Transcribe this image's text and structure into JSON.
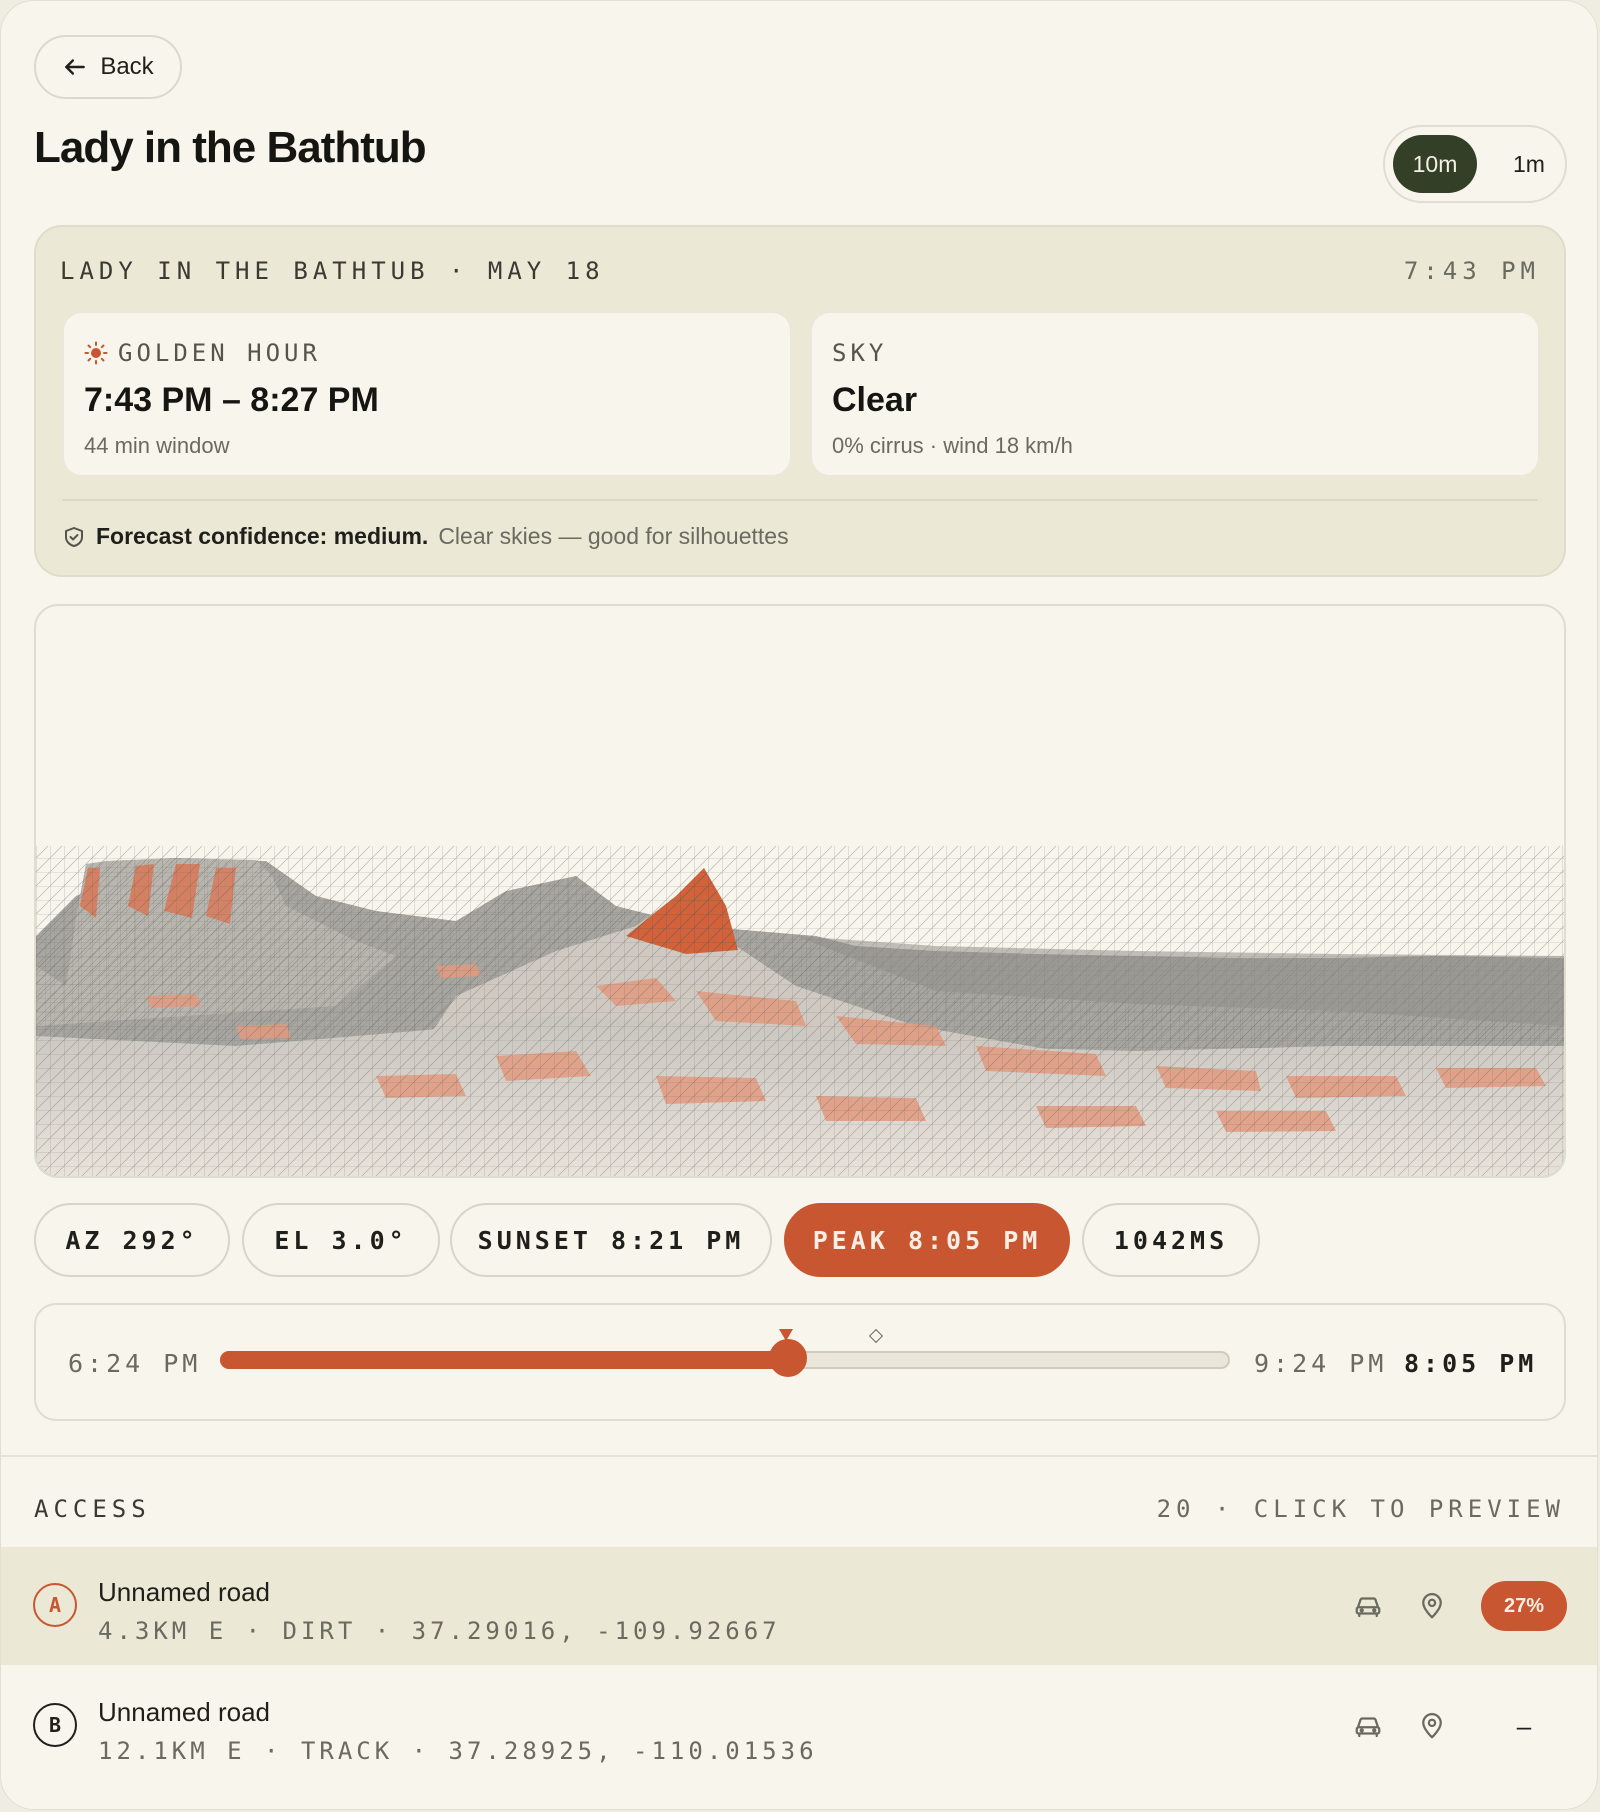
{
  "header": {
    "back_label": "Back",
    "title": "Lady in the Bathtub",
    "resolution_options": [
      "10m",
      "1m"
    ],
    "resolution_selected": "10m"
  },
  "forecast": {
    "heading": "LADY IN THE BATHTUB · MAY 18",
    "time": "7:43 PM",
    "golden_hour": {
      "label": "GOLDEN HOUR",
      "value": "7:43 PM – 8:27 PM",
      "sub": "44 min window"
    },
    "sky": {
      "label": "SKY",
      "value": "Clear",
      "sub": "0% cirrus · wind 18 km/h"
    },
    "confidence_label": "Forecast confidence: medium.",
    "confidence_note": "Clear skies — good for silhouettes"
  },
  "chips": {
    "az": "AZ 292°",
    "el": "EL 3.0°",
    "sunset": "SUNSET 8:21 PM",
    "peak": "PEAK 8:05 PM",
    "render_time": "1042MS"
  },
  "timeline": {
    "start": "6:24 PM",
    "end": "9:24 PM",
    "current": "8:05 PM",
    "progress": 0.561,
    "peak_position": 0.561,
    "sunset_position": 0.65
  },
  "access": {
    "label": "ACCESS",
    "count_text": "20 · CLICK TO PREVIEW",
    "items": [
      {
        "badge": "A",
        "name": "Unnamed road",
        "meta": "4.3KM E · DIRT · 37.29016, -109.92667",
        "percent": "27%",
        "icons": [
          "car-icon",
          "map-pin-icon"
        ]
      },
      {
        "badge": "B",
        "name": "Unnamed road",
        "meta": "12.1KM E · TRACK · 37.28925, -110.01536",
        "percent": "–",
        "icons": [
          "car-icon",
          "map-pin-icon"
        ]
      }
    ]
  },
  "colors": {
    "accent": "#c85731",
    "dark_green": "#333f26",
    "panel": "#ebe8d6",
    "background": "#f8f5ec"
  }
}
